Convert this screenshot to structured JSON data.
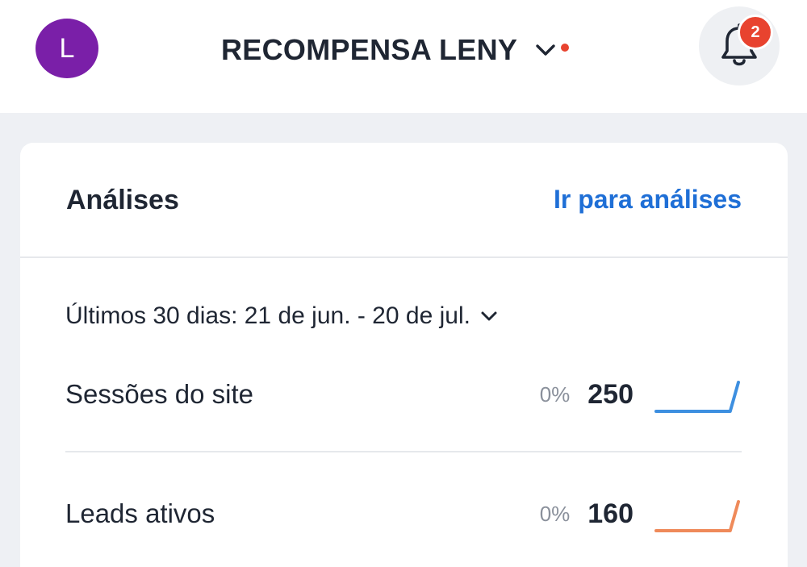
{
  "header": {
    "avatar_initial": "L",
    "avatar_color": "#7a1fa8",
    "site_name": "RECOMPENSA LENY",
    "site_indicator_color": "#e8432f",
    "notification_count": "2",
    "badge_color": "#e8432f",
    "icons": [
      "chevron-down-icon",
      "bell-icon"
    ]
  },
  "analytics": {
    "title": "Análises",
    "link_label": "Ir para análises",
    "link_color": "#1f6fd6",
    "date_range_label": "Últimos 30 dias: 21 de jun. - 20 de jul.",
    "metrics": [
      {
        "label": "Sessões do site",
        "change": "0%",
        "value": "250",
        "color": "#3d8fe0",
        "trend": [
          0,
          0,
          0,
          0,
          0,
          0,
          0,
          0,
          0,
          0,
          1
        ]
      },
      {
        "label": "Leads ativos",
        "change": "0%",
        "value": "160",
        "color": "#ef8a5a",
        "trend": [
          0,
          0,
          0,
          0,
          0,
          0,
          0,
          0,
          0,
          0,
          1
        ]
      }
    ]
  }
}
